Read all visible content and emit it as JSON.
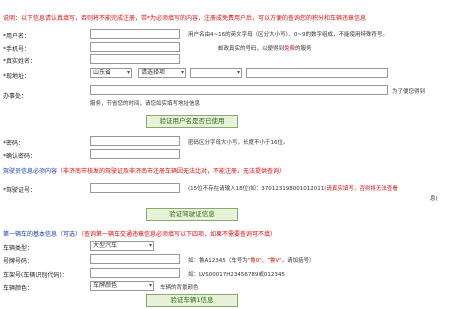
{
  "notice": "说明：以下信息请认真填写，否则将不能完成注册，带*为必须填写的内容，注册成免费用户后，可以方便的查询您的积分和车辆违章信息",
  "account": {
    "username_label": "*用户名：",
    "username_hint": "用户名由4~16的英文字母（区分大小写）、0~9的数字组成，不能使用特殊符号。",
    "phone_label": "*手机号：",
    "phone_hint_a": "邮政真实的号码，以便得到",
    "phone_hint_free": "免费",
    "phone_hint_b": "的服务",
    "realname_label": "*真实姓名：",
    "region_label": "*现地址：",
    "province": "山东省",
    "city": "请选择项",
    "district": "",
    "street": "",
    "service_label": "办事处：",
    "service_hint_right": "为了便您得到",
    "service_hint_bottom": "服务，节省您的时间，请您如实填写地址信息",
    "check_button": "验证用户名是否已使用"
  },
  "password": {
    "password_label": "*密码：",
    "password_hint": "密码区分字母大小写，长度不小于16位。",
    "confirm_label": "*确认密码："
  },
  "license": {
    "title_a": "驾驶员信息必须内容",
    "title_b": "（非济南市核发的驾驶证及非济南市注册车辆因无法比对，不能注册，无法提供查询）",
    "id_label": "*驾驶证号：",
    "id_hint_a": "(15位不存在请输入18位)如：370123198001012011",
    "id_hint_b": "(请真实填写，否则将无法查看",
    "id_hint_c": "息)",
    "check_button": "验证驾驶证信息"
  },
  "vehicle": {
    "title_a": "第一辆车的基本信息（可选）",
    "title_b": "（查询第一辆车交通违章信息必须填写以下四项，如果不需要查询可不填）",
    "type_label": "车辆类型：",
    "type_value": "大型汽车",
    "plate_label": "号牌号码：",
    "plate_hint_a": "如：鲁A12345（车号为",
    "plate_hint_b": "\"鲁0\"、\"鲁V\"",
    "plate_hint_c": "，请加括号）",
    "vin_label": "车架号(车辆识别代码)：",
    "vin_hint": "如：LVS00017H23456789或012345",
    "color_label": "车辆颜色：",
    "color_value": "车牌颜色",
    "color_hint": "车辆的背景颜色",
    "check_button": "验证车辆1信息"
  },
  "colors": {
    "accent_red": "#d01010",
    "link_blue": "#1b3fa8",
    "button_bg": "#e8f2d8"
  }
}
